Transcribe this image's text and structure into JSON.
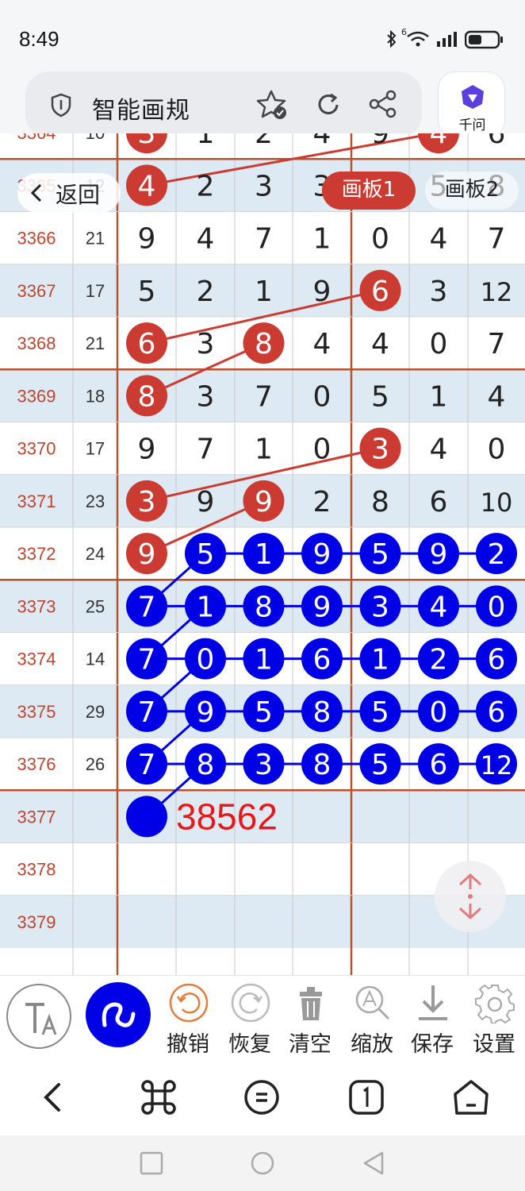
{
  "status_bar": {
    "time": "8:49",
    "signal_label": "6"
  },
  "browser": {
    "address_title": "智能画规",
    "qianwen_label": "千问",
    "icons": [
      "shield-icon",
      "star-check-icon",
      "refresh-icon",
      "share-icon",
      "qianwen-logo-icon"
    ]
  },
  "overlay": {
    "back_label": "返回",
    "board1_label": "画板1",
    "board2_label": "画板2"
  },
  "grid": {
    "rows": [
      {
        "id": "3364",
        "sum": "10",
        "d": [
          "3",
          "1",
          "2",
          "4",
          "9",
          "4",
          "6"
        ]
      },
      {
        "id": "3365",
        "sum": "12",
        "d": [
          "4",
          "2",
          "3",
          "3",
          "5",
          "5",
          "8"
        ]
      },
      {
        "id": "3366",
        "sum": "21",
        "d": [
          "9",
          "4",
          "7",
          "1",
          "0",
          "4",
          "7"
        ]
      },
      {
        "id": "3367",
        "sum": "17",
        "d": [
          "5",
          "2",
          "1",
          "9",
          "6",
          "3",
          "12"
        ]
      },
      {
        "id": "3368",
        "sum": "21",
        "d": [
          "6",
          "3",
          "8",
          "4",
          "4",
          "0",
          "7"
        ]
      },
      {
        "id": "3369",
        "sum": "18",
        "d": [
          "8",
          "3",
          "7",
          "0",
          "5",
          "1",
          "4"
        ]
      },
      {
        "id": "3370",
        "sum": "17",
        "d": [
          "9",
          "7",
          "1",
          "0",
          "3",
          "4",
          "0"
        ]
      },
      {
        "id": "3371",
        "sum": "23",
        "d": [
          "3",
          "9",
          "9",
          "2",
          "8",
          "6",
          "10"
        ]
      },
      {
        "id": "3372",
        "sum": "24",
        "d": [
          "9",
          "5",
          "1",
          "9",
          "5",
          "9",
          "2"
        ]
      },
      {
        "id": "3373",
        "sum": "25",
        "d": [
          "7",
          "1",
          "8",
          "9",
          "3",
          "4",
          "0"
        ]
      },
      {
        "id": "3374",
        "sum": "14",
        "d": [
          "7",
          "0",
          "1",
          "6",
          "1",
          "2",
          "6"
        ]
      },
      {
        "id": "3375",
        "sum": "29",
        "d": [
          "7",
          "9",
          "5",
          "8",
          "5",
          "0",
          "6"
        ]
      },
      {
        "id": "3376",
        "sum": "26",
        "d": [
          "7",
          "8",
          "3",
          "8",
          "5",
          "6",
          "12"
        ]
      },
      {
        "id": "3377",
        "sum": "",
        "d": [
          "",
          "",
          "",
          "",
          "",
          "",
          ""
        ]
      },
      {
        "id": "3378",
        "sum": "",
        "d": [
          "",
          "",
          "",
          "",
          "",
          "",
          ""
        ]
      },
      {
        "id": "3379",
        "sum": "",
        "d": [
          "",
          "",
          "",
          "",
          "",
          "",
          ""
        ]
      }
    ],
    "red_marks": [
      [
        0,
        0
      ],
      [
        0,
        5
      ],
      [
        1,
        0
      ],
      [
        3,
        4
      ],
      [
        4,
        0
      ],
      [
        4,
        2
      ],
      [
        5,
        0
      ],
      [
        6,
        4
      ],
      [
        7,
        0
      ],
      [
        7,
        2
      ],
      [
        8,
        0
      ]
    ],
    "red_lines": [
      [
        [
          1,
          0
        ],
        [
          0,
          5
        ]
      ],
      [
        [
          3,
          4
        ],
        [
          4,
          0
        ]
      ],
      [
        [
          4,
          2
        ],
        [
          5,
          0
        ]
      ],
      [
        [
          6,
          4
        ],
        [
          7,
          0
        ]
      ],
      [
        [
          7,
          2
        ],
        [
          8,
          0
        ]
      ]
    ],
    "blue_rows": [
      8,
      9,
      10,
      11,
      12
    ],
    "blue_start_col": 1,
    "blue_first_col_from_row": 9,
    "blue_empty_circle": [
      13,
      0
    ],
    "prediction_text": "38562",
    "colors": {
      "red": "#cc3b32",
      "blue": "#0000e6",
      "id_text": "#c0452f",
      "frame": "#b5542f",
      "band": "#dde9f3"
    }
  },
  "toolbar": {
    "undo": "撤销",
    "redo": "恢复",
    "clear": "清空",
    "zoom": "缩放",
    "save": "保存",
    "settings": "设置"
  }
}
